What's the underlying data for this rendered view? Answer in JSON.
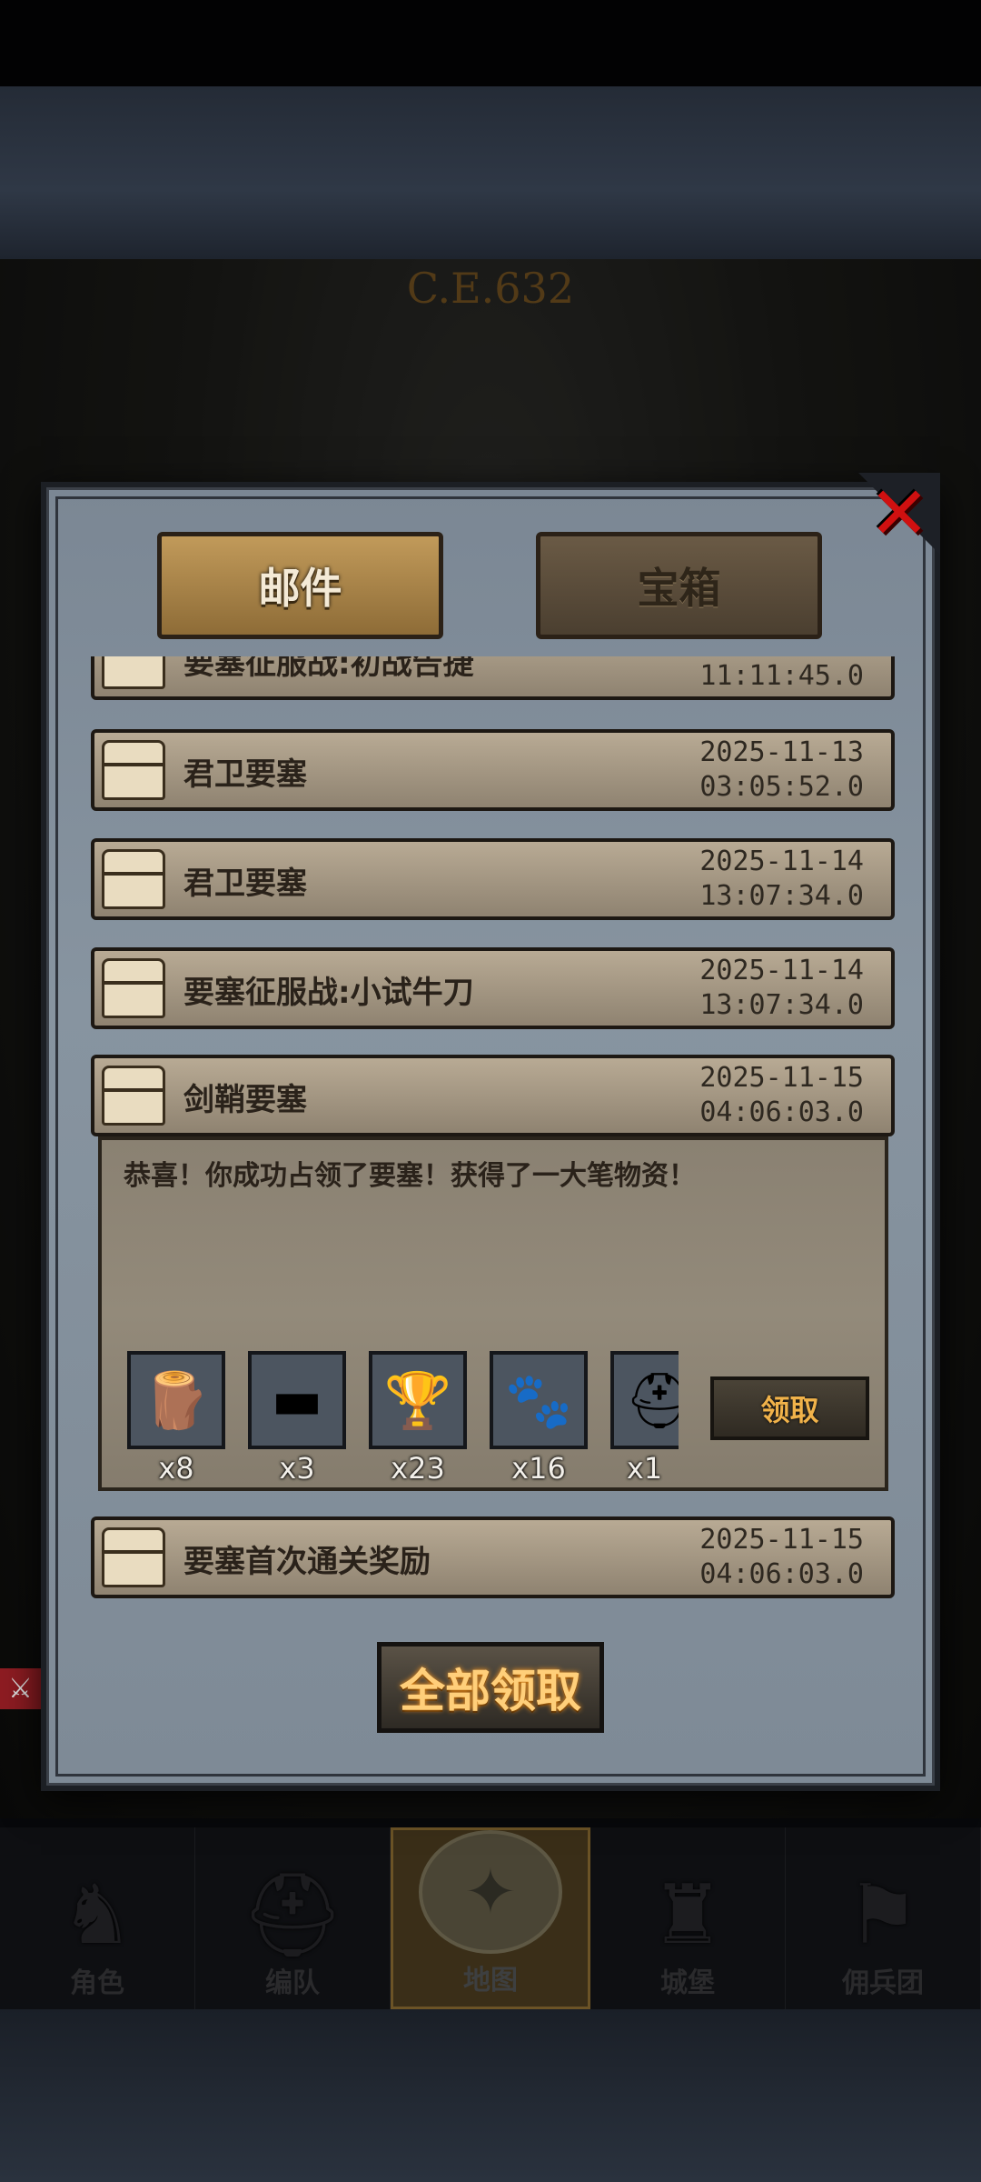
{
  "calendar": "C.E.632",
  "tabs": {
    "mail": "邮件",
    "chest": "宝箱"
  },
  "mails": [
    {
      "title": "要塞征服战:初战告捷",
      "date": "",
      "time": "11:11:45.0"
    },
    {
      "title": "君卫要塞",
      "date": "2025-11-13",
      "time": "03:05:52.0"
    },
    {
      "title": "君卫要塞",
      "date": "2025-11-14",
      "time": "13:07:34.0"
    },
    {
      "title": "要塞征服战:小试牛刀",
      "date": "2025-11-14",
      "time": "13:07:34.0"
    },
    {
      "title": "剑鞘要塞",
      "date": "2025-11-15",
      "time": "04:06:03.0"
    },
    {
      "title": "要塞首次通关奖励",
      "date": "2025-11-15",
      "time": "04:06:03.0"
    }
  ],
  "detail": {
    "message": "恭喜！你成功占领了要塞！获得了一大笔物资！",
    "rewards": [
      {
        "icon": "wood-log-icon",
        "qty": "x8"
      },
      {
        "icon": "iron-ingot-icon",
        "qty": "x3"
      },
      {
        "icon": "goblet-icon",
        "qty": "x23"
      },
      {
        "icon": "fur-pelt-icon",
        "qty": "x16"
      },
      {
        "icon": "gold-helmet-icon",
        "qty": "x1"
      }
    ],
    "claim_label": "领取"
  },
  "claim_all_label": "全部领取",
  "nav": [
    "角色",
    "编队",
    "地图",
    "城堡",
    "佣兵团"
  ],
  "nav_active": "地图"
}
